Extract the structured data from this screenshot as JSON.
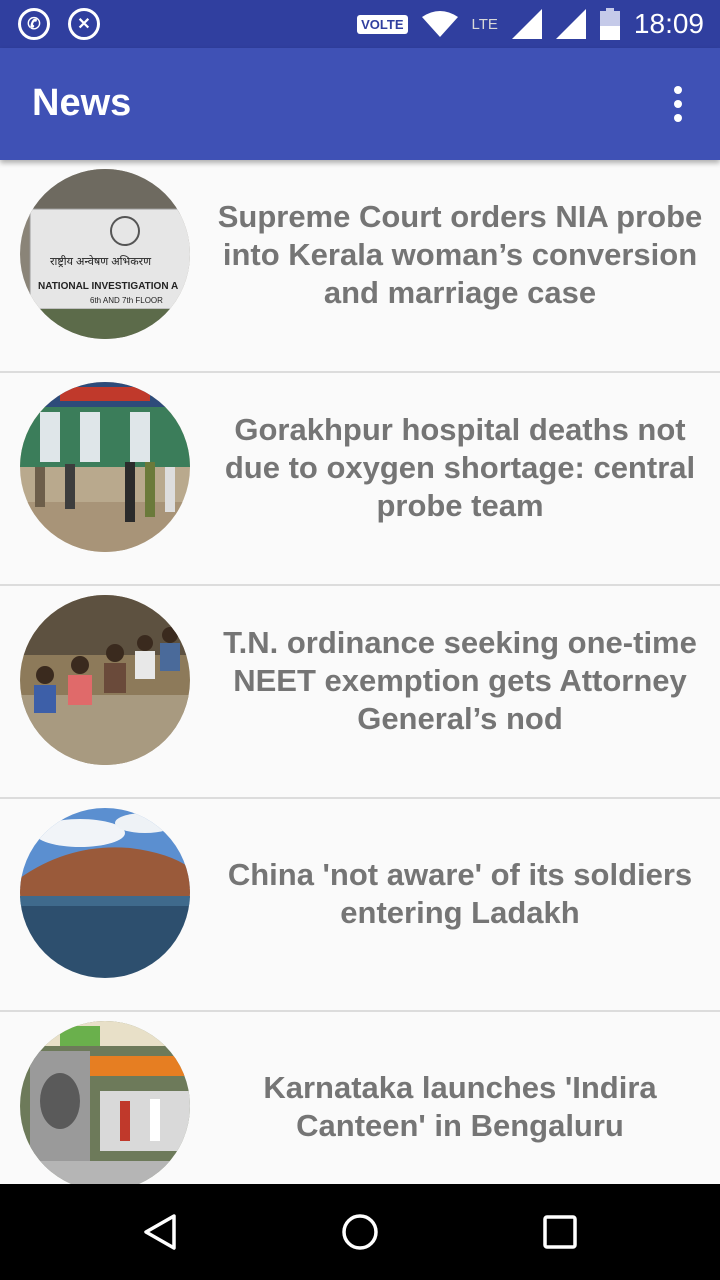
{
  "status_bar": {
    "icons": [
      "whatsapp-icon",
      "app-icon",
      "volte-badge",
      "wifi-icon",
      "lte-icon",
      "signal-icon",
      "signal-icon",
      "battery-icon"
    ],
    "volte": "VOLTE",
    "lte": "LTE",
    "time": "18:09"
  },
  "app_bar": {
    "title": "News",
    "menu_icon": "more-vert-icon",
    "color": "#3f51b5"
  },
  "news": [
    {
      "headline": "Supreme Court orders NIA probe into Kerala woman’s conversion and marriage case",
      "thumbnail": "nia-building-sign"
    },
    {
      "headline": "Gorakhpur hospital deaths not due to oxygen shortage: central probe team",
      "thumbnail": "hospital-entrance"
    },
    {
      "headline": "T.N. ordinance seeking one-time NEET exemption gets Attorney General’s nod",
      "thumbnail": "students-waiting"
    },
    {
      "headline": "China 'not aware' of its soldiers entering Ladakh",
      "thumbnail": "ladakh-lake"
    },
    {
      "headline": "Karnataka launches 'Indira Canteen' in Bengaluru",
      "thumbnail": "indira-canteen"
    }
  ],
  "nav_bar": {
    "buttons": [
      "back-icon",
      "home-icon",
      "recents-icon"
    ]
  }
}
